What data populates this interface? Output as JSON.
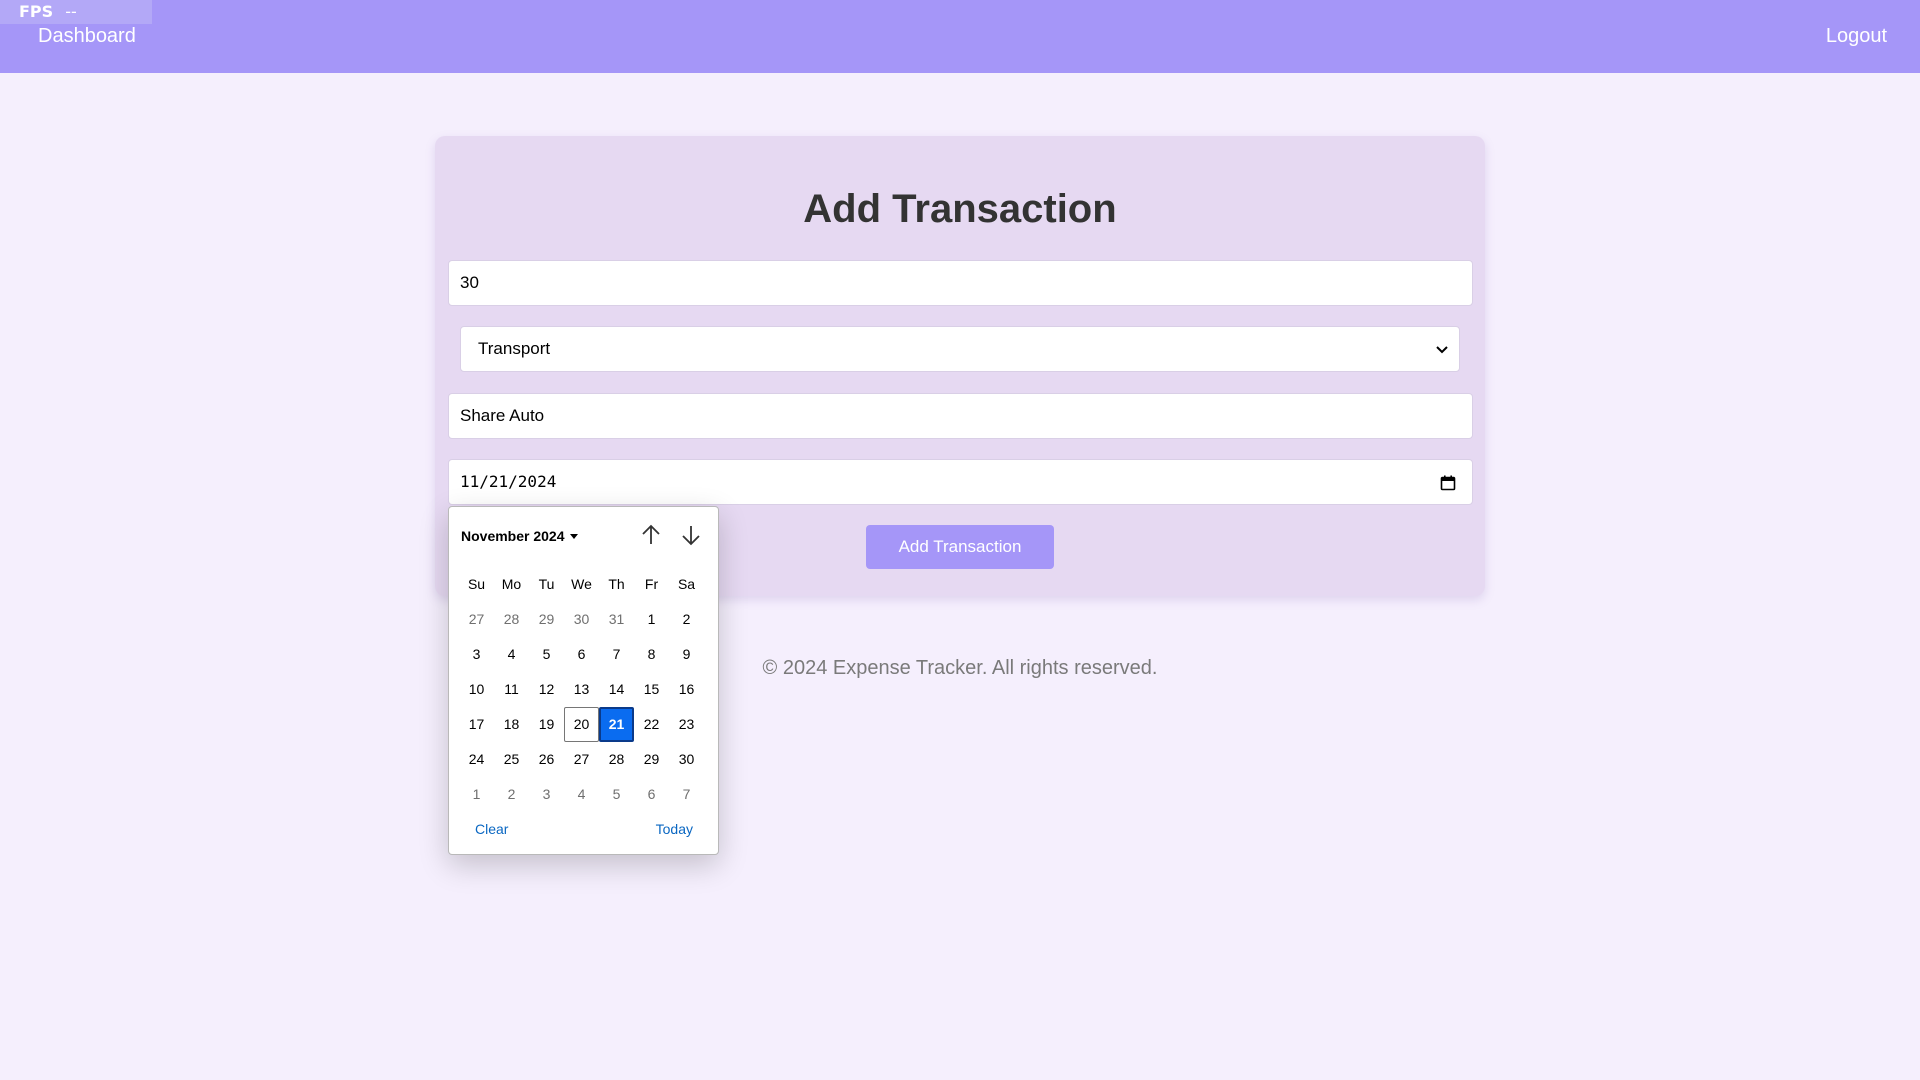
{
  "fps": {
    "label": "FPS",
    "value": "--"
  },
  "nav": {
    "dashboard": "Dashboard",
    "logout": "Logout"
  },
  "form": {
    "title": "Add Transaction",
    "amount_value": "30",
    "category_selected": "Transport",
    "description_value": "Share Auto",
    "date_value": "11/21/2024",
    "submit_label": "Add Transaction"
  },
  "footer": {
    "text": "© 2024 Expense Tracker. All rights reserved."
  },
  "datepicker": {
    "month_label": "November 2024",
    "weekdays": [
      "Su",
      "Mo",
      "Tu",
      "We",
      "Th",
      "Fr",
      "Sa"
    ],
    "weeks": [
      [
        {
          "d": "27",
          "other": true
        },
        {
          "d": "28",
          "other": true
        },
        {
          "d": "29",
          "other": true
        },
        {
          "d": "30",
          "other": true
        },
        {
          "d": "31",
          "other": true
        },
        {
          "d": "1"
        },
        {
          "d": "2"
        }
      ],
      [
        {
          "d": "3"
        },
        {
          "d": "4"
        },
        {
          "d": "5"
        },
        {
          "d": "6"
        },
        {
          "d": "7"
        },
        {
          "d": "8"
        },
        {
          "d": "9"
        }
      ],
      [
        {
          "d": "10"
        },
        {
          "d": "11"
        },
        {
          "d": "12"
        },
        {
          "d": "13"
        },
        {
          "d": "14"
        },
        {
          "d": "15"
        },
        {
          "d": "16"
        }
      ],
      [
        {
          "d": "17"
        },
        {
          "d": "18"
        },
        {
          "d": "19"
        },
        {
          "d": "20",
          "outline": true
        },
        {
          "d": "21",
          "selected": true
        },
        {
          "d": "22"
        },
        {
          "d": "23"
        }
      ],
      [
        {
          "d": "24"
        },
        {
          "d": "25"
        },
        {
          "d": "26"
        },
        {
          "d": "27"
        },
        {
          "d": "28"
        },
        {
          "d": "29"
        },
        {
          "d": "30"
        }
      ],
      [
        {
          "d": "1",
          "other": true
        },
        {
          "d": "2",
          "other": true
        },
        {
          "d": "3",
          "other": true
        },
        {
          "d": "4",
          "other": true
        },
        {
          "d": "5",
          "other": true
        },
        {
          "d": "6",
          "other": true
        },
        {
          "d": "7",
          "other": true
        }
      ]
    ],
    "clear_label": "Clear",
    "today_label": "Today",
    "selected_color": "#0a6cf0",
    "link_color": "#0a67c2"
  },
  "colors": {
    "navbar": "#a596f8",
    "page_background": "#f5effd",
    "card_background": "#e6d9f2",
    "button": "#a596f8"
  },
  "icons": {
    "select_arrow": "chevron-down-icon",
    "date_field": "calendar-icon",
    "picker_prev": "arrow-up-icon",
    "picker_next": "arrow-down-icon"
  }
}
